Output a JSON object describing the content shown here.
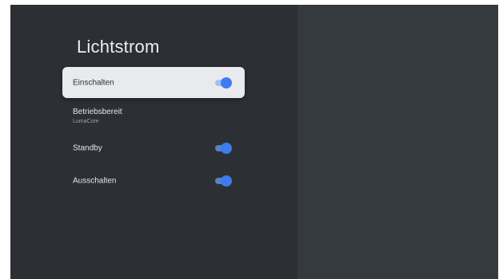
{
  "page": {
    "title": "Lichtstrom"
  },
  "settings": [
    {
      "label": "Einschalten",
      "toggle_on": true,
      "focused": true
    },
    {
      "label": "Betriebsbereit",
      "sublabel": "LumaCore"
    },
    {
      "label": "Standby",
      "toggle_on": true
    },
    {
      "label": "Ausschalten",
      "toggle_on": true
    }
  ],
  "colors": {
    "background": "#2c3034",
    "right_pane": "#353a3f",
    "focused_row": "#e8eaed",
    "toggle_accent": "#3d7cf0"
  }
}
